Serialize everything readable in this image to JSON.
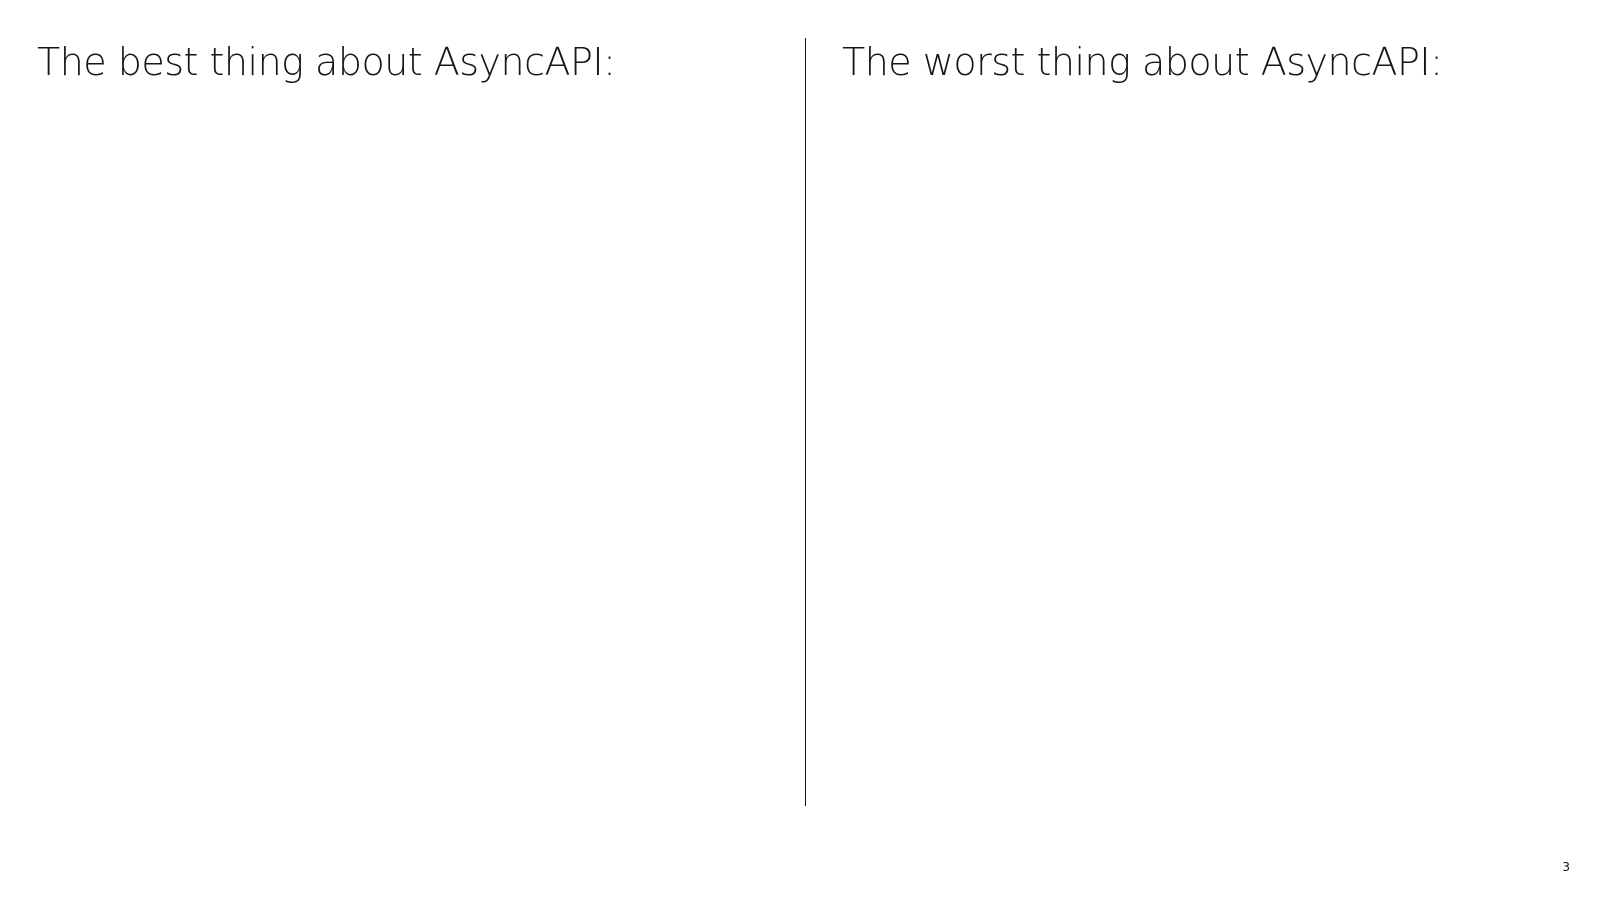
{
  "slide": {
    "left_column": {
      "heading": "The best thing about AsyncAPI:"
    },
    "right_column": {
      "heading": "The worst thing about AsyncAPI:"
    },
    "page_number": "3"
  },
  "colors": {
    "background": "#ffffff",
    "text": "#161616",
    "divider": "#161616"
  }
}
